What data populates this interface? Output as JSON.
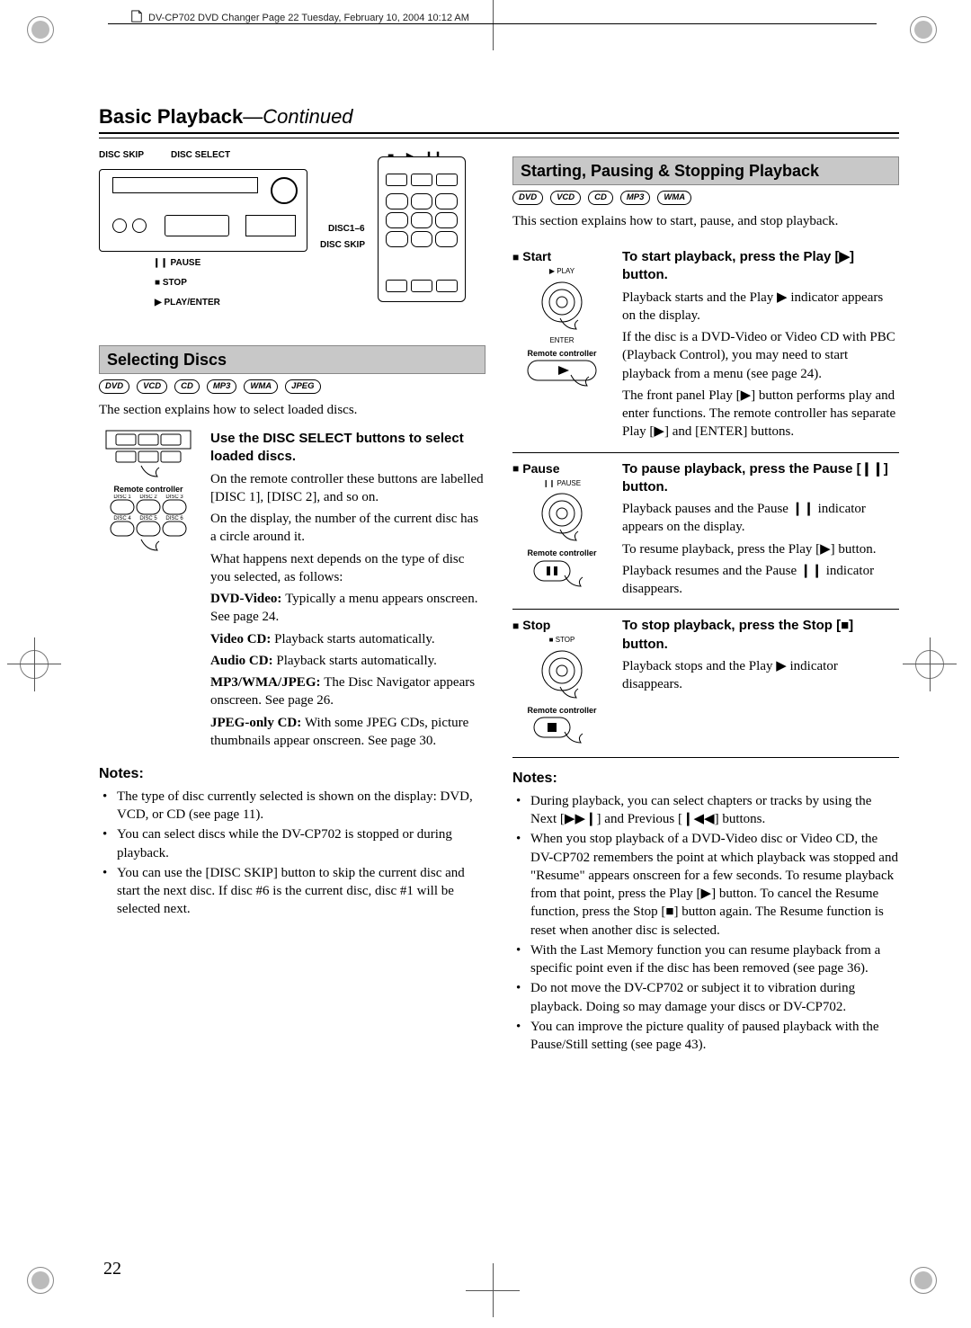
{
  "running_header": "DV-CP702 DVD Changer  Page 22  Tuesday, February 10, 2004  10:12 AM",
  "section_title": "Basic Playback",
  "section_title_suffix": "—Continued",
  "page_number": "22",
  "fig_labels": {
    "disc_skip": "DISC SKIP",
    "disc_select": "DISC SELECT",
    "disc_1_6": "DISC1–6",
    "pause": "PAUSE",
    "stop": "STOP",
    "play_enter": "PLAY/ENTER",
    "disc_skip2": "DISC SKIP"
  },
  "selecting": {
    "heading": "Selecting Discs",
    "badges": [
      "DVD",
      "VCD",
      "CD",
      "MP3",
      "WMA",
      "JPEG"
    ],
    "intro": "The section explains how to select loaded discs.",
    "lead": "Use the DISC SELECT buttons to select loaded discs.",
    "p1": "On the remote controller these buttons are labelled [DISC 1], [DISC 2], and so on.",
    "p2": "On the display, the number of the current disc has a circle around it.",
    "p3": "What happens next depends on the type of disc you selected, as follows:",
    "dvd_video": "DVD-Video: ",
    "dvd_video_txt": "Typically a menu appears onscreen. See page 24.",
    "video_cd": "Video CD: ",
    "video_cd_txt": "Playback starts automatically.",
    "audio_cd": "Audio CD: ",
    "audio_cd_txt": "Playback starts automatically.",
    "mp3": "MP3/WMA/JPEG: ",
    "mp3_txt": "The Disc Navigator appears onscreen. See page 26.",
    "jpeg_only": "JPEG-only CD: ",
    "jpeg_only_txt": "With some JPEG CDs, picture thumbnails appear onscreen. See page 30.",
    "remote_caption": "Remote controller",
    "disc_btn_captions": [
      "DISC 1",
      "DISC 2",
      "DISC 3",
      "DISC 4",
      "DISC 5",
      "DISC 6"
    ]
  },
  "notes_left_h": "Notes:",
  "notes_left": [
    "The type of disc currently selected is shown on the display: DVD, VCD, or CD (see page 11).",
    "You can select discs while the DV-CP702 is stopped or during playback.",
    "You can use the [DISC SKIP] button to skip the current disc and start the next disc. If disc #6 is the current disc, disc #1 will be selected next."
  ],
  "starting": {
    "heading": "Starting, Pausing & Stopping Playback",
    "badges": [
      "DVD",
      "VCD",
      "CD",
      "MP3",
      "WMA"
    ],
    "intro": "This section explains how to start, pause, and stop playback.",
    "rows": {
      "start": {
        "label": "Start",
        "btn_top_label": "PLAY",
        "btn_bot_label": "ENTER",
        "remote_caption": "Remote controller",
        "lead": "To start playback, press the Play [▶] button.",
        "p1": "Playback starts and the Play ▶ indicator appears on the display.",
        "p2": "If the disc is a DVD-Video or Video CD with PBC (Playback Control), you may need to start playback from a menu (see page 24).",
        "p3": "The front panel Play [▶] button performs play and enter functions. The remote controller has separate Play [▶] and [ENTER] buttons."
      },
      "pause": {
        "label": "Pause",
        "btn_top_label": "PAUSE",
        "remote_caption": "Remote controller",
        "lead": "To pause playback, press the Pause [❙❙] button.",
        "p1": "Playback pauses and the Pause ❙❙ indicator appears on the display.",
        "p2": "To resume playback, press the Play [▶] button.",
        "p3": "Playback resumes and the Pause ❙❙ indicator disappears."
      },
      "stop": {
        "label": "Stop",
        "btn_top_label": "STOP",
        "remote_caption": "Remote controller",
        "lead": "To stop playback, press the Stop [■] button.",
        "p1": "Playback stops and the Play ▶ indicator disappears."
      }
    }
  },
  "notes_right_h": "Notes:",
  "notes_right": [
    "During playback, you can select chapters or tracks by using the Next [▶▶❙] and Previous [❙◀◀] buttons.",
    "When you stop playback of a DVD-Video disc or Video CD, the DV-CP702 remembers the point at which playback was stopped and \"Resume\" appears onscreen for a few seconds. To resume playback from that point, press the Play [▶] button. To cancel the Resume function, press the Stop [■] button again. The Resume function is reset when another disc is selected.",
    "With the Last Memory function you can resume playback from a specific point even if the disc has been removed (see page 36).",
    "Do not move the DV-CP702 or subject it to vibration during playback. Doing so may damage your discs or DV-CP702.",
    "You can improve the picture quality of paused playback with the Pause/Still setting (see page 43)."
  ]
}
